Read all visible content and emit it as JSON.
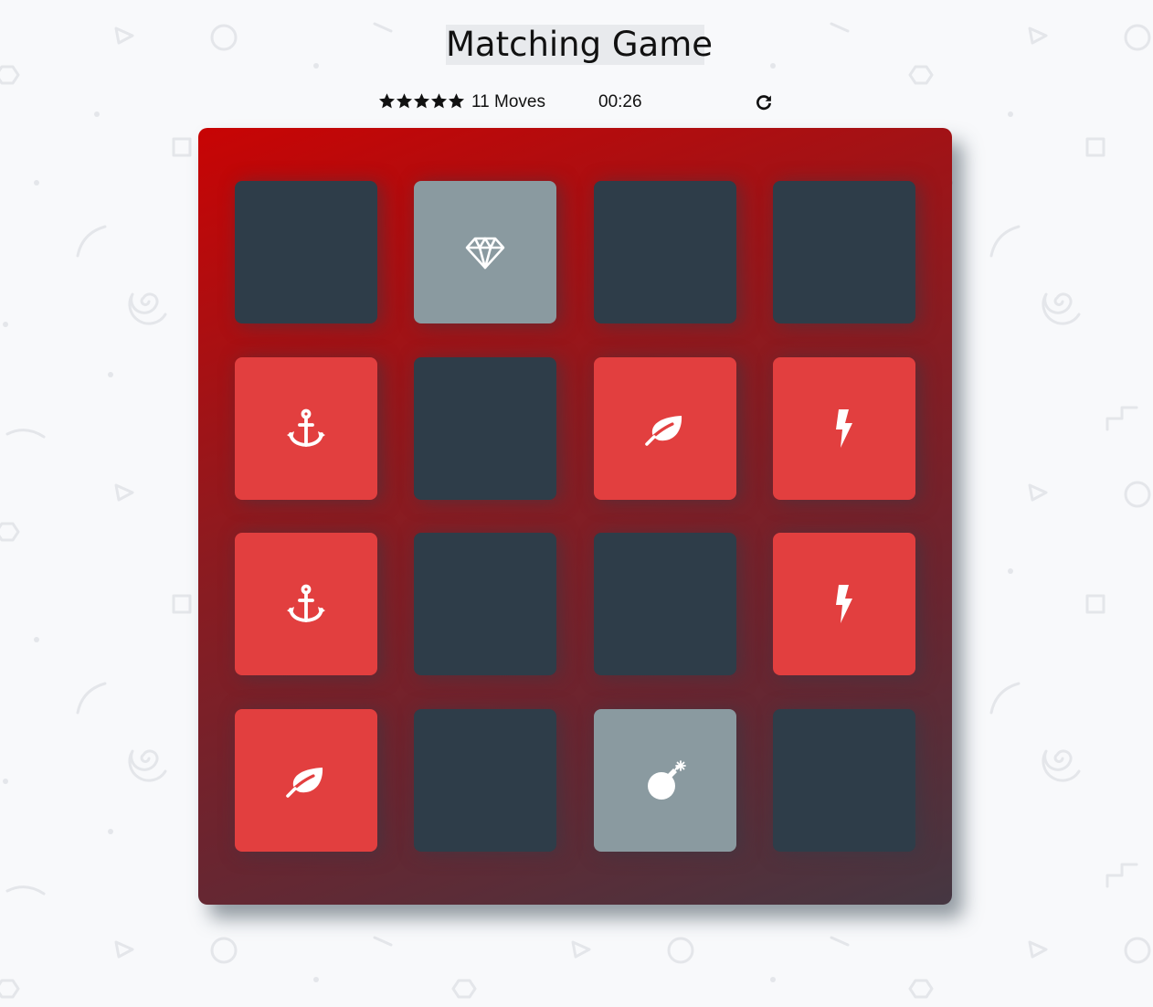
{
  "title": "Matching Game",
  "score_panel": {
    "star_rating": 5,
    "star_max": 5,
    "moves_label": "11 Moves",
    "timer": "00:26",
    "restart_icon": "restart-icon"
  },
  "deck": {
    "gradient_colors": [
      "#c80404",
      "#453742"
    ],
    "card_colors": {
      "hidden": "#2e3d49",
      "open": "#8a9aa0",
      "match": "#e23f3f"
    },
    "cards": [
      {
        "state": "hidden",
        "icon": "unknown"
      },
      {
        "state": "open",
        "icon": "diamond"
      },
      {
        "state": "hidden",
        "icon": "unknown"
      },
      {
        "state": "hidden",
        "icon": "unknown"
      },
      {
        "state": "match",
        "icon": "anchor"
      },
      {
        "state": "hidden",
        "icon": "unknown"
      },
      {
        "state": "match",
        "icon": "leaf"
      },
      {
        "state": "match",
        "icon": "bolt"
      },
      {
        "state": "match",
        "icon": "anchor"
      },
      {
        "state": "hidden",
        "icon": "unknown"
      },
      {
        "state": "hidden",
        "icon": "unknown"
      },
      {
        "state": "match",
        "icon": "bolt"
      },
      {
        "state": "match",
        "icon": "leaf"
      },
      {
        "state": "hidden",
        "icon": "unknown"
      },
      {
        "state": "open",
        "icon": "bomb"
      },
      {
        "state": "hidden",
        "icon": "unknown"
      }
    ]
  }
}
